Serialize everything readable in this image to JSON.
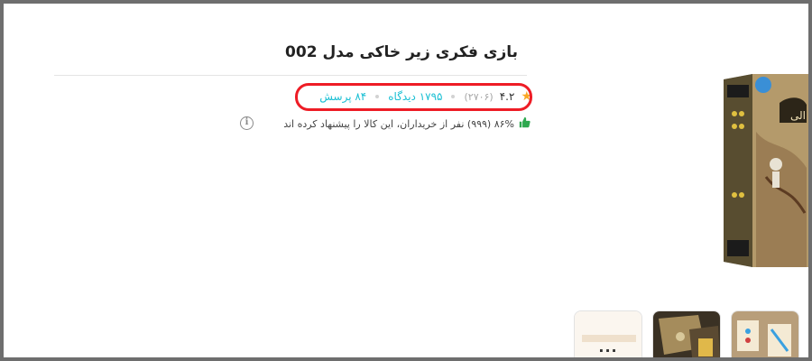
{
  "product": {
    "title": "بازی فکری زیر خاکی مدل 002",
    "rating": "۴.۲",
    "rating_count": "(۲۷۰۶)",
    "reviews_link": "۱۷۹۵ دیدگاه",
    "questions_link": "۸۴ پرسش",
    "recommendation_text": "۸۶% (۹۹۹) نفر از خریداران، این کالا را پیشنهاد کرده اند"
  },
  "gallery": {
    "more_label": "..."
  },
  "colors": {
    "accent_link": "#19bfd3",
    "star": "#f9a825",
    "highlight_outline": "#ee1c25",
    "recommend_icon": "#2ea84f"
  },
  "icons": {
    "rating": "star-icon",
    "recommend": "thumbs-up-icon",
    "info": "info-icon",
    "more": "more-dots-icon"
  }
}
